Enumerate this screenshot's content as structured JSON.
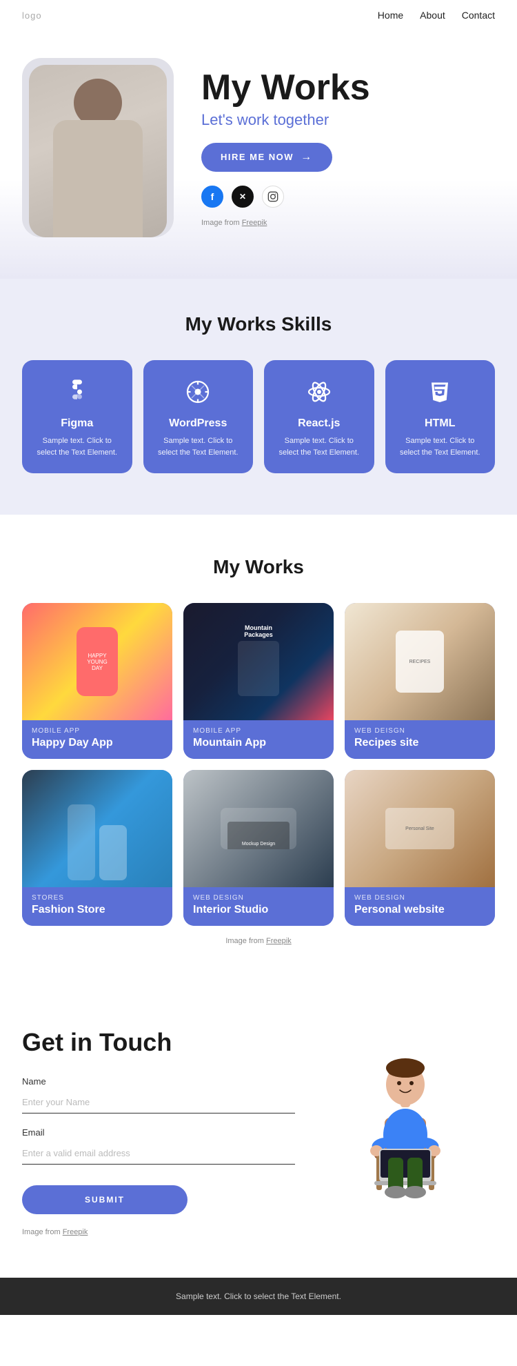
{
  "nav": {
    "logo": "logo",
    "links": [
      {
        "label": "Home",
        "id": "home"
      },
      {
        "label": "About",
        "id": "about"
      },
      {
        "label": "Contact",
        "id": "contact"
      }
    ]
  },
  "hero": {
    "title": "My Works",
    "subtitle": "Let's work together",
    "cta_button": "HIRE ME NOW",
    "credit_text": "Image from ",
    "credit_link": "Freepik",
    "social": [
      {
        "icon": "f",
        "name": "facebook",
        "class": "fb"
      },
      {
        "icon": "✕",
        "name": "twitter",
        "class": "tw"
      },
      {
        "icon": "◯",
        "name": "instagram",
        "class": "ig"
      }
    ]
  },
  "skills": {
    "section_title": "My Works Skills",
    "items": [
      {
        "name": "Figma",
        "icon": "figma",
        "desc": "Sample text. Click to select the Text Element."
      },
      {
        "name": "WordPress",
        "icon": "wordpress",
        "desc": "Sample text. Click to select the Text Element."
      },
      {
        "name": "React.js",
        "icon": "react",
        "desc": "Sample text. Click to select the Text Element."
      },
      {
        "name": "HTML",
        "icon": "html5",
        "desc": "Sample text. Click to select the Text Element."
      }
    ]
  },
  "works": {
    "section_title": "My Works",
    "credit_text": "Image from ",
    "credit_link": "Freepik",
    "items": [
      {
        "category": "MOBILE APP",
        "title": "Happy Day App",
        "img_class": "img-happy-day"
      },
      {
        "category": "MOBILE APP",
        "title": "Mountain App",
        "img_class": "img-mountain"
      },
      {
        "category": "WEB DEISGN",
        "title": "Recipes site",
        "img_class": "img-recipes"
      },
      {
        "category": "STORES",
        "title": "Fashion Store",
        "img_class": "img-fashion"
      },
      {
        "category": "WEB DESIGN",
        "title": "Interior Studio",
        "img_class": "img-interior"
      },
      {
        "category": "WEB DESIGN",
        "title": "Personal website",
        "img_class": "img-personal"
      }
    ]
  },
  "contact": {
    "title": "Get in Touch",
    "name_label": "Name",
    "name_placeholder": "Enter your Name",
    "email_label": "Email",
    "email_placeholder": "Enter a valid email address",
    "submit_button": "SUBMIT",
    "credit_text": "Image from ",
    "credit_link": "Freepik"
  },
  "footer": {
    "text": "Sample text. Click to select the Text Element."
  }
}
